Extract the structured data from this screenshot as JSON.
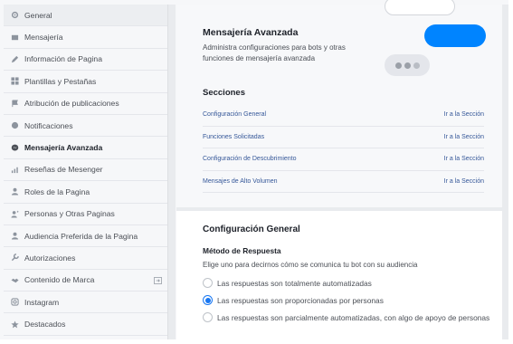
{
  "sidebar": {
    "items": [
      {
        "label": "General",
        "icon": "gear-icon"
      },
      {
        "label": "Mensajería",
        "icon": "message-icon"
      },
      {
        "label": "Información de Pagina",
        "icon": "pencil-icon"
      },
      {
        "label": "Plantillas y Pestañas",
        "icon": "grid-icon"
      },
      {
        "label": "Atribución de publicaciones",
        "icon": "flag-icon"
      },
      {
        "label": "Notificaciones",
        "icon": "globe-icon"
      },
      {
        "label": "Mensajería Avanzada",
        "icon": "messenger-icon",
        "active": true
      },
      {
        "label": "Reseñas de Mesenger",
        "icon": "bars-icon"
      },
      {
        "label": "Roles de la Pagina",
        "icon": "person-icon"
      },
      {
        "label": "Personas y Otras Paginas",
        "icon": "people-icon"
      },
      {
        "label": "Audiencia Preferida de la Pagina",
        "icon": "person-icon"
      },
      {
        "label": "Autorizaciones",
        "icon": "wrench-icon"
      },
      {
        "label": "Contenido de Marca",
        "icon": "handshake-icon"
      },
      {
        "label": "Instagram",
        "icon": "instagram-icon"
      },
      {
        "label": "Destacados",
        "icon": "star-icon"
      }
    ]
  },
  "main": {
    "title": "Mensajería Avanzada",
    "description": "Administra configuraciones para bots y otras funciones de mensajería avanzada",
    "sections_title": "Secciones",
    "sections": [
      {
        "name": "Configuración General",
        "link": "Ir a la Sección"
      },
      {
        "name": "Funciones Solicitadas",
        "link": "Ir a la Sección"
      },
      {
        "name": "Configuración de Descubrimiento",
        "link": "Ir a la Sección"
      },
      {
        "name": "Mensajes de Alto Volumen",
        "link": "Ir a la Sección"
      }
    ],
    "config": {
      "title": "Configuración General",
      "subtitle": "Método de Respuesta",
      "description": "Elige uno para decirnos cómo se comunica tu bot con su audiencia",
      "options": [
        {
          "label": "Las respuestas son totalmente automatizadas",
          "checked": false
        },
        {
          "label": "Las respuestas son proporcionadas por personas",
          "checked": true
        },
        {
          "label": "Las respuestas son parcialmente automatizadas, con algo de apoyo de personas",
          "checked": false
        }
      ]
    }
  },
  "colors": {
    "accent": "#0084ff",
    "link": "#365899",
    "radio": "#1877f2"
  }
}
